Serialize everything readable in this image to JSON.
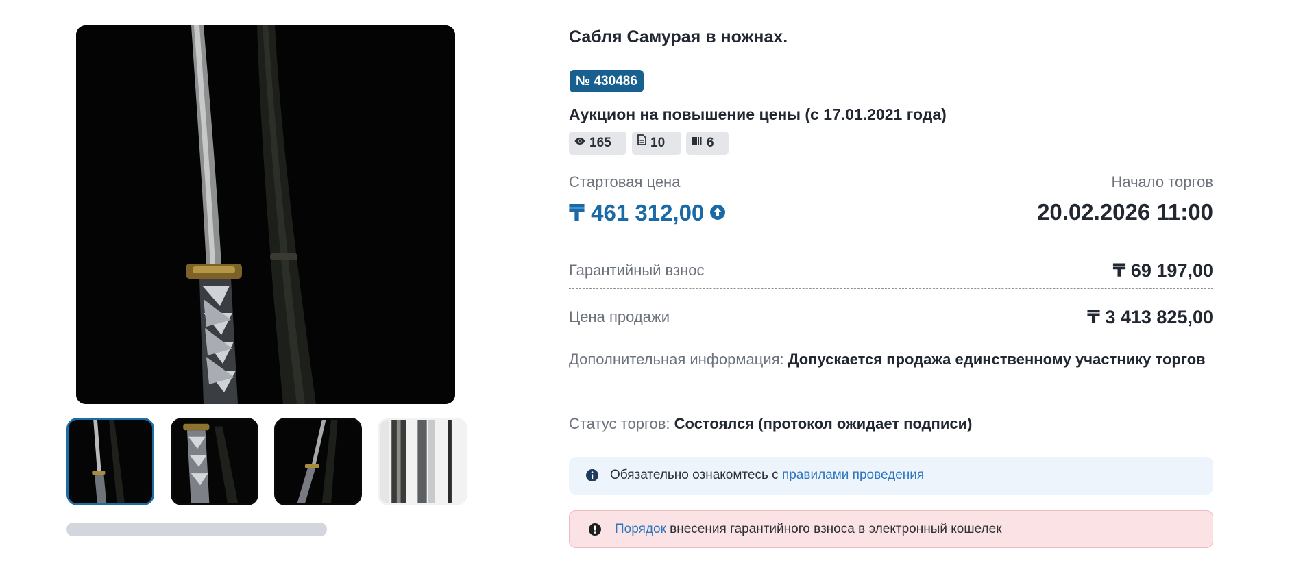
{
  "gallery": {
    "thumbnails": [
      "photo 1",
      "photo 2",
      "photo 3",
      "photo 4"
    ],
    "active_index": 0
  },
  "lot": {
    "title": "Сабля Самурая в ножнах.",
    "number": "№ 430486",
    "auction_type": "Аукцион на повышение цены (с 17.01.2021 года)",
    "stats": {
      "views": "165",
      "documents": "10",
      "bids": "6"
    }
  },
  "pricing": {
    "start_price_label": "Стартовая цена",
    "start_price": "₸ 461 312,00",
    "trade_start_label": "Начало торгов",
    "trade_start": "20.02.2026 11:00",
    "deposit_label": "Гарантийный взнос",
    "deposit": "₸ 69 197,00",
    "sale_price_label": "Цена продажи",
    "sale_price": "₸ 3 413 825,00"
  },
  "details": {
    "extra_label": "Дополнительная информация:",
    "extra_value": "Допускается продажа единственному участнику торгов",
    "status_label": "Статус торгов:",
    "status_value": "Состоялся (протокол ожидает подписи)"
  },
  "notices": {
    "info_prefix": "Обязательно ознакомтесь с",
    "info_link": "правилами проведения",
    "warn_link": "Порядок",
    "warn_suffix": "внесения гарантийного взноса в электронный кошелек"
  },
  "colors": {
    "accent": "#1a6aa8",
    "badge": "#17608f",
    "info_bg": "#eef4fb",
    "warn_bg": "#fbe2e4"
  }
}
